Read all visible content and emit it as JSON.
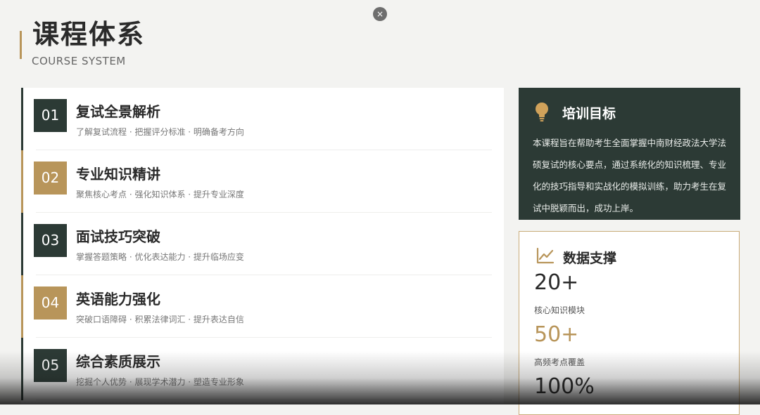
{
  "header": {
    "title": "课程体系",
    "subtitle": "COURSE SYSTEM",
    "close_label": "×"
  },
  "courses": [
    {
      "num": "01",
      "title": "复试全景解析",
      "desc": "了解复试流程 · 把握评分标准 · 明确备考方向"
    },
    {
      "num": "02",
      "title": "专业知识精讲",
      "desc": "聚焦核心考点 · 强化知识体系 · 提升专业深度"
    },
    {
      "num": "03",
      "title": "面试技巧突破",
      "desc": "掌握答题策略 · 优化表达能力 · 提升临场应变"
    },
    {
      "num": "04",
      "title": "英语能力强化",
      "desc": "突破口语障碍 · 积累法律词汇 · 提升表达自信"
    },
    {
      "num": "05",
      "title": "综合素质展示",
      "desc": "挖掘个人优势 · 展现学术潜力 · 塑造专业形象"
    }
  ],
  "goal": {
    "icon": "lightbulb-icon",
    "title": "培训目标",
    "text": "本课程旨在帮助考生全面掌握中南财经政法大学法硕复试的核心要点，通过系统化的知识梳理、专业化的技巧指导和实战化的模拟训练，助力考生在复试中脱颖而出，成功上岸。"
  },
  "data_support": {
    "icon": "line-chart-icon",
    "title": "数据支撑",
    "stats": [
      {
        "value": "20+",
        "label": "核心知识模块"
      },
      {
        "value": "50+",
        "label": "高频考点覆盖"
      },
      {
        "value": "100%",
        "label": ""
      }
    ]
  },
  "colors": {
    "dark": "#2c3a35",
    "gold": "#b8955a",
    "background": "#f3f3f1"
  }
}
